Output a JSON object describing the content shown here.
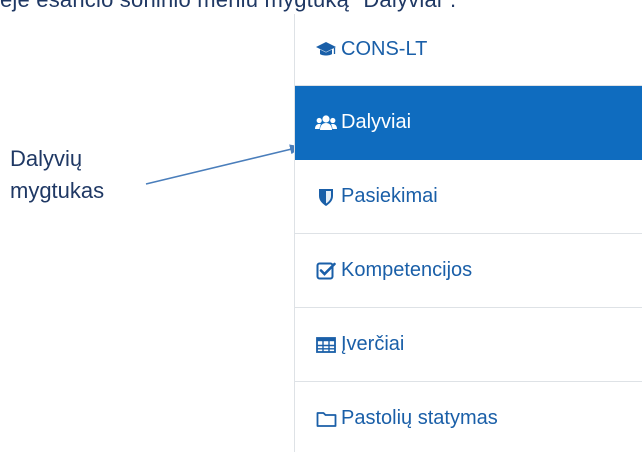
{
  "caption_top": "ėje esančio šoninio meniu mygtuką \"Dalyviai\".",
  "callout": {
    "line1": "Dalyvių",
    "line2": "mygtukas"
  },
  "menu": {
    "brand": {
      "label": "CONS-LT",
      "icon": "graduation-cap-icon"
    },
    "items": [
      {
        "label": "Dalyviai",
        "icon": "users-icon",
        "active": true
      },
      {
        "label": "Pasiekimai",
        "icon": "shield-icon",
        "active": false
      },
      {
        "label": "Kompetencijos",
        "icon": "check-square-icon",
        "active": false
      },
      {
        "label": "Įverčiai",
        "icon": "table-icon",
        "active": false
      },
      {
        "label": "Pastolių statymas",
        "icon": "folder-icon",
        "active": false
      }
    ]
  },
  "colors": {
    "active_bg": "#0f6cbf",
    "link": "#1a5fa8",
    "annotation": "#1f3864",
    "arrow": "#4a7ebb"
  }
}
